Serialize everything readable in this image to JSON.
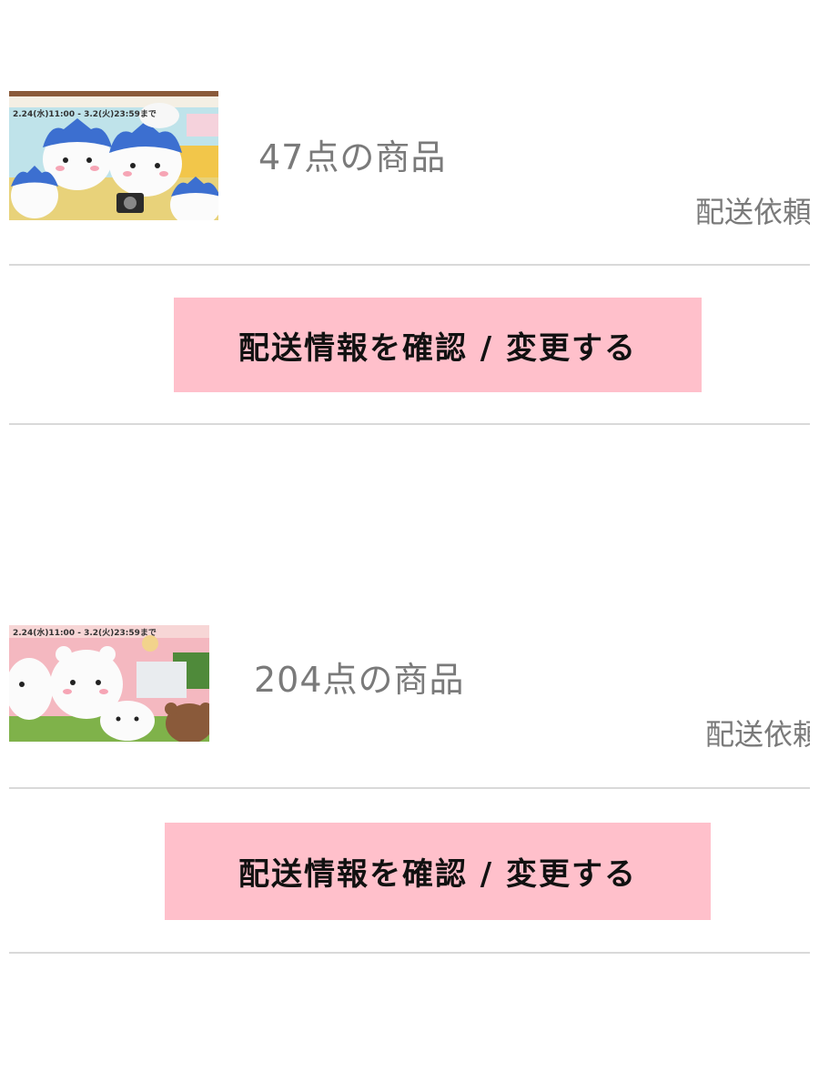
{
  "colors": {
    "button_bg": "#ffc0cb",
    "button_text": "#111111",
    "muted_text": "#7a7a7a",
    "divider": "#d9d9d9"
  },
  "orders": [
    {
      "thumbnail_date": "2.24(水)11:00 - 3.2(火)23:59まで",
      "item_count": "47点の商品",
      "status_label": "配送依頼",
      "button_label": "配送情報を確認 / 変更する",
      "thumbnail_icon": "hachiware-plush-thumbnail"
    },
    {
      "thumbnail_date": "2.24(水)11:00 - 3.2(火)23:59まで",
      "item_count": "204点の商品",
      "status_label": "配送依頼",
      "button_label": "配送情報を確認 / 変更する",
      "thumbnail_icon": "chiikawa-plush-thumbnail"
    }
  ]
}
